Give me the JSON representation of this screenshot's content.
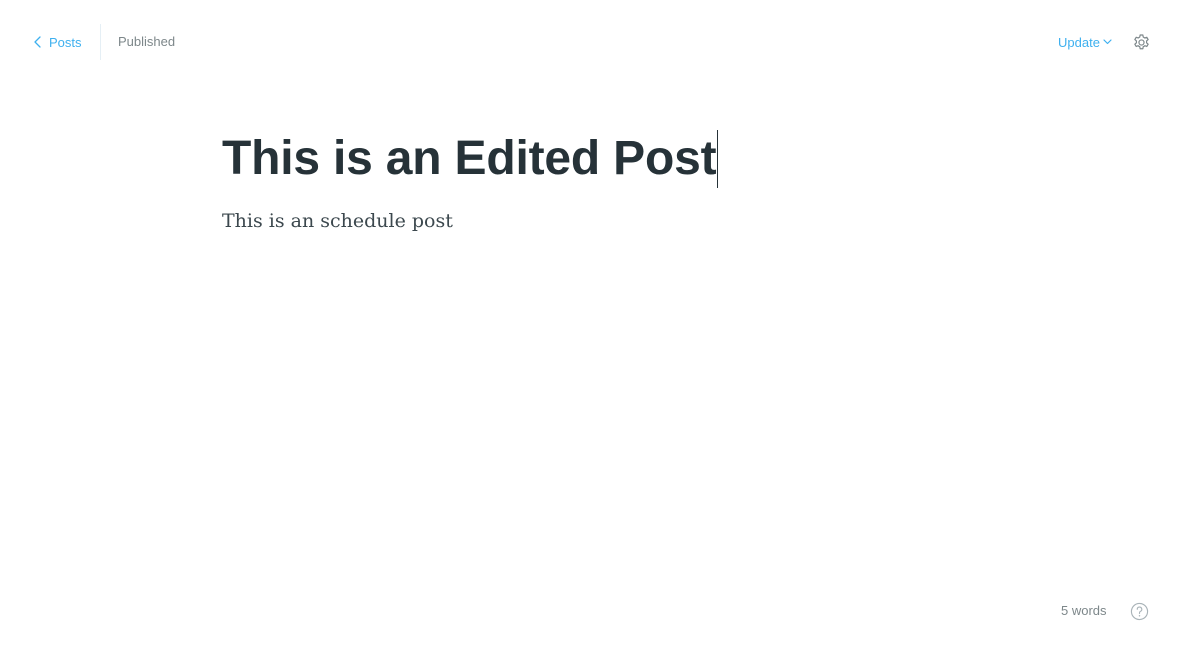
{
  "header": {
    "back_label": "Posts",
    "status": "Published",
    "update_label": "Update"
  },
  "editor": {
    "title": "This is an Edited Post",
    "body": "This is an schedule post"
  },
  "footer": {
    "word_count": "5 words"
  },
  "icons": {
    "back": "chevron-left-icon",
    "update_dropdown": "chevron-down-icon",
    "settings": "gear-icon",
    "help": "question-circle-icon"
  },
  "colors": {
    "accent": "#3eb0ef",
    "muted": "#7d878a",
    "title": "#263238"
  }
}
